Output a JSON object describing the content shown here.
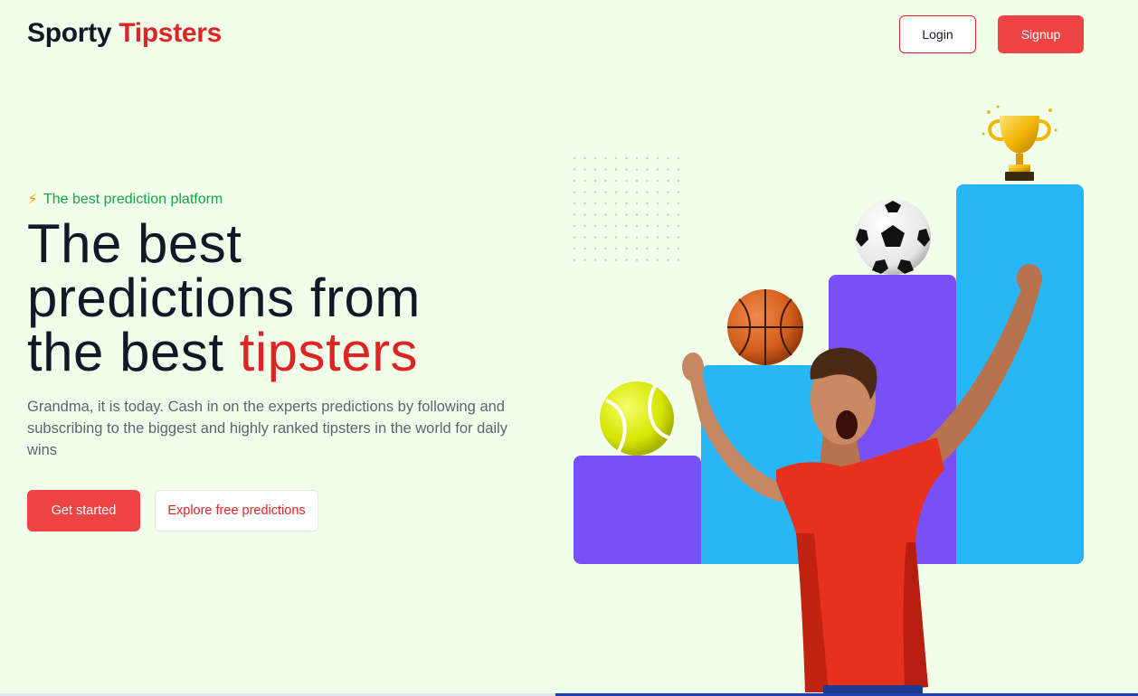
{
  "header": {
    "brand_part1": "Sporty",
    "brand_part2": "Tipsters",
    "login_label": "Login",
    "signup_label": "Signup"
  },
  "hero": {
    "tagline_icon": "lightning-bolt-icon",
    "tagline": "The best prediction platform",
    "headline_line1": "The best",
    "headline_line2": "predictions from",
    "headline_line3_plain": "the best ",
    "headline_line3_accent": "tipsters",
    "subtext": "Grandma, it is today. Cash in on the experts predictions by following and subscribing to the biggest and highly ranked tipsters in the world for daily wins",
    "cta_primary": "Get started",
    "cta_secondary": "Explore free predictions"
  },
  "illustration": {
    "items": [
      "tennis-ball-icon",
      "basketball-icon",
      "soccer-ball-icon",
      "trophy-icon",
      "celebrating-player"
    ]
  },
  "colors": {
    "background": "#f1ffea",
    "brand_red": "#ef4444",
    "accent_red": "#dc2626",
    "tagline_green": "#16a34a",
    "bar_purple": "#7950f8",
    "bar_blue": "#29b6f6"
  }
}
